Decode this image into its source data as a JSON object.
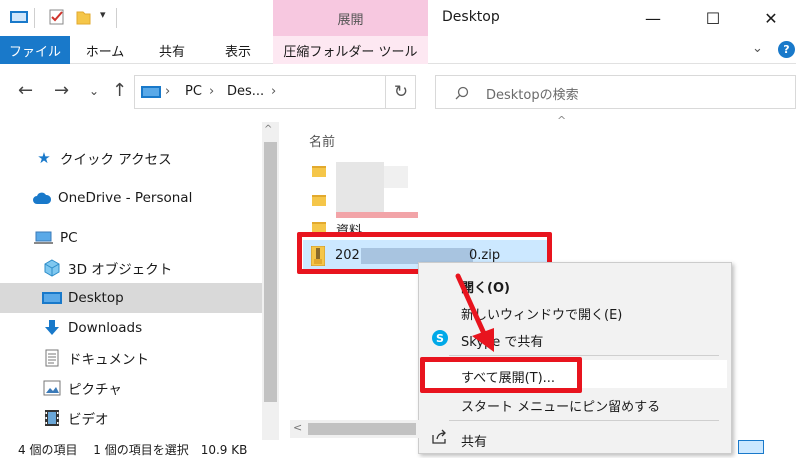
{
  "window": {
    "title": "Desktop",
    "contextual_tab_header": "展開",
    "minimize_glyph": "—",
    "maximize_glyph": "☐",
    "close_glyph": "✕"
  },
  "ribbon": {
    "tabs": [
      {
        "label": "ファイル"
      },
      {
        "label": "ホーム"
      },
      {
        "label": "共有"
      },
      {
        "label": "表示"
      },
      {
        "label": "圧縮フォルダー ツール"
      }
    ],
    "expand_glyph": "⌄",
    "help_glyph": "?"
  },
  "address": {
    "back_glyph": "←",
    "forward_glyph": "→",
    "recent_glyph": "⌄",
    "up_glyph": "↑",
    "crumbs": [
      "PC",
      "Des..."
    ],
    "sep_glyph": "›",
    "refresh_glyph": "↻",
    "search_placeholder": "Desktopの検索"
  },
  "nav": {
    "items": [
      {
        "label": "クイック アクセス",
        "icon": "star-icon"
      },
      {
        "label": "OneDrive - Personal",
        "icon": "cloud-icon"
      },
      {
        "label": "PC",
        "icon": "computer-icon"
      },
      {
        "label": "3D オブジェクト",
        "icon": "cube-icon"
      },
      {
        "label": "Desktop",
        "icon": "desktop-icon",
        "selected": true
      },
      {
        "label": "Downloads",
        "icon": "download-icon"
      },
      {
        "label": "ドキュメント",
        "icon": "document-icon"
      },
      {
        "label": "ピクチャ",
        "icon": "pictures-icon"
      },
      {
        "label": "ビデオ",
        "icon": "video-icon"
      }
    ]
  },
  "content": {
    "column_name": "名前",
    "sort_glyph": "^",
    "visible_fragment": "資料",
    "zip_file": {
      "prefix": "202",
      "suffix": "0.zip"
    }
  },
  "context_menu": {
    "items": [
      {
        "label": "開く(O)",
        "bold": true
      },
      {
        "label": "新しいウィンドウで開く(E)"
      },
      {
        "label": "Skype で共有"
      },
      {
        "label": "すべて展開(T)..."
      },
      {
        "label": "スタート メニューにピン留めする"
      },
      {
        "label": "共有"
      }
    ]
  },
  "scroll": {
    "left_glyph": "<",
    "up_glyph": "^"
  },
  "status": {
    "text": "4 個の項目　 1 個の項目を選択　10.9 KB"
  },
  "colors": {
    "file_tab": "#1979ca",
    "contextual_header": "#f7c8e0",
    "selection": "#cce8ff",
    "highlight": "#e8141e",
    "folder": "#f5c649"
  }
}
